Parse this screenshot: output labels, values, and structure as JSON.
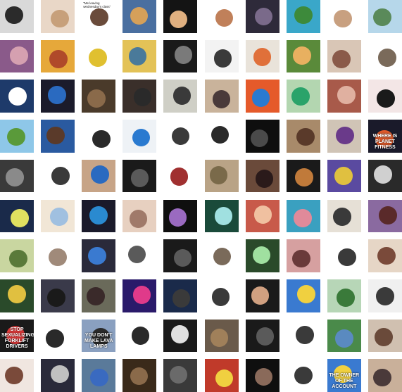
{
  "grid": {
    "cols": 10,
    "rows": 10,
    "tiles": [
      {
        "bg": "#d9d9d9",
        "fg": "#2b2b2b",
        "dark": true,
        "caption": "",
        "big": ""
      },
      {
        "bg": "#e9d7c7",
        "fg": "#c7a07b",
        "dark": false,
        "caption": "",
        "big": ""
      },
      {
        "bg": "#ffffff",
        "fg": "#6a4b3b",
        "dark": false,
        "caption": "\"Me leaving wednesday's class\"",
        "big": ""
      },
      {
        "bg": "#4a6fa0",
        "fg": "#d5a05a",
        "dark": true,
        "caption": "",
        "big": ""
      },
      {
        "bg": "#141414",
        "fg": "#e0b080",
        "dark": true,
        "caption": "",
        "big": ""
      },
      {
        "bg": "#ffffff",
        "fg": "#c0805a",
        "dark": false,
        "caption": "",
        "big": ""
      },
      {
        "bg": "#2e2a3a",
        "fg": "#7a6a8a",
        "dark": true,
        "caption": "",
        "big": ""
      },
      {
        "bg": "#3aa7c9",
        "fg": "#3d8a3b",
        "dark": true,
        "caption": "",
        "big": ""
      },
      {
        "bg": "#ffffff",
        "fg": "#c8a080",
        "dark": false,
        "caption": "",
        "big": ""
      },
      {
        "bg": "#b6d7ea",
        "fg": "#5a8a5a",
        "dark": false,
        "caption": "",
        "big": ""
      },
      {
        "bg": "#8a5a8a",
        "fg": "#d5a0b0",
        "dark": true,
        "caption": "",
        "big": ""
      },
      {
        "bg": "#e6a83a",
        "fg": "#b04a2a",
        "dark": false,
        "caption": "",
        "big": ""
      },
      {
        "bg": "#ffffff",
        "fg": "#e0c030",
        "dark": false,
        "caption": "",
        "big": ""
      },
      {
        "bg": "#e3c257",
        "fg": "#4a7a9a",
        "dark": false,
        "caption": "",
        "big": ""
      },
      {
        "bg": "#1a1a1a",
        "fg": "#7a7a7a",
        "dark": true,
        "caption": "",
        "big": ""
      },
      {
        "bg": "#f3f3f3",
        "fg": "#3a3a3a",
        "dark": false,
        "caption": "",
        "big": ""
      },
      {
        "bg": "#e9e3da",
        "fg": "#e0703a",
        "dark": false,
        "caption": "",
        "big": ""
      },
      {
        "bg": "#5a8a3a",
        "fg": "#e8b060",
        "dark": true,
        "caption": "",
        "big": ""
      },
      {
        "bg": "#d9c6b6",
        "fg": "#8a5a4a",
        "dark": false,
        "caption": "",
        "big": ""
      },
      {
        "bg": "#ffffff",
        "fg": "#7a6a5a",
        "dark": false,
        "caption": "",
        "big": ""
      },
      {
        "bg": "#1e3a6a",
        "fg": "#ffffff",
        "dark": true,
        "caption": "",
        "big": ""
      },
      {
        "bg": "#1b1b2b",
        "fg": "#2a6ac0",
        "dark": true,
        "caption": "",
        "big": ""
      },
      {
        "bg": "#4a3a2a",
        "fg": "#8a6a4a",
        "dark": true,
        "caption": "",
        "big": ""
      },
      {
        "bg": "#3a2f2a",
        "fg": "#2a2a2a",
        "dark": true,
        "caption": "",
        "big": ""
      },
      {
        "bg": "#cfcfc6",
        "fg": "#3a3a3a",
        "dark": false,
        "caption": "",
        "big": ""
      },
      {
        "bg": "#c9b39b",
        "fg": "#4a3a3a",
        "dark": false,
        "caption": "",
        "big": ""
      },
      {
        "bg": "#e55a2a",
        "fg": "#2a7ad0",
        "dark": true,
        "caption": "",
        "big": ""
      },
      {
        "bg": "#b3d6b0",
        "fg": "#2aa36a",
        "dark": false,
        "caption": "",
        "big": ""
      },
      {
        "bg": "#a85a4a",
        "fg": "#e0b0a0",
        "dark": true,
        "caption": "",
        "big": ""
      },
      {
        "bg": "#f3e6e6",
        "fg": "#1a1a1a",
        "dark": false,
        "caption": "",
        "big": ""
      },
      {
        "bg": "#8ec7e8",
        "fg": "#5a9a3a",
        "dark": false,
        "caption": "",
        "big": ""
      },
      {
        "bg": "#2a5aa0",
        "fg": "#5a3a2a",
        "dark": true,
        "caption": "",
        "big": ""
      },
      {
        "bg": "#ffffff",
        "fg": "#2a2a2a",
        "dark": false,
        "caption": "",
        "big": ""
      },
      {
        "bg": "#eef2f6",
        "fg": "#2a7ad0",
        "dark": false,
        "caption": "",
        "big": ""
      },
      {
        "bg": "#ffffff",
        "fg": "#3a3a3a",
        "dark": false,
        "caption": "",
        "big": ""
      },
      {
        "bg": "#ffffff",
        "fg": "#2a2a2a",
        "dark": false,
        "caption": "",
        "big": ""
      },
      {
        "bg": "#0e0e0e",
        "fg": "#4a4a4a",
        "dark": true,
        "caption": "",
        "big": ""
      },
      {
        "bg": "#a88a6a",
        "fg": "#5a3a2a",
        "dark": false,
        "caption": "",
        "big": ""
      },
      {
        "bg": "#d0c4b6",
        "fg": "#6a3a8a",
        "dark": false,
        "caption": "",
        "big": ""
      },
      {
        "bg": "#1a1a2a",
        "fg": "#e05a2a",
        "dark": true,
        "caption": "",
        "big": "WHERE IS  PLANET FITNESS"
      },
      {
        "bg": "#3a3a3a",
        "fg": "#8a8a8a",
        "dark": true,
        "caption": "",
        "big": ""
      },
      {
        "bg": "#ffffff",
        "fg": "#3a3a3a",
        "dark": false,
        "caption": "",
        "big": ""
      },
      {
        "bg": "#c7a487",
        "fg": "#2a6ac0",
        "dark": false,
        "caption": "",
        "big": ""
      },
      {
        "bg": "#1a1a1a",
        "fg": "#5a5a5a",
        "dark": true,
        "caption": "",
        "big": ""
      },
      {
        "bg": "#ffffff",
        "fg": "#a03030",
        "dark": false,
        "caption": "",
        "big": ""
      },
      {
        "bg": "#b9a386",
        "fg": "#7a6a4a",
        "dark": false,
        "caption": "",
        "big": ""
      },
      {
        "bg": "#6a4a3a",
        "fg": "#2a1a1a",
        "dark": true,
        "caption": "",
        "big": ""
      },
      {
        "bg": "#1a1a1a",
        "fg": "#c07a3a",
        "dark": true,
        "caption": "",
        "big": ""
      },
      {
        "bg": "#5a4aa0",
        "fg": "#e0c040",
        "dark": true,
        "caption": "",
        "big": ""
      },
      {
        "bg": "#2a2a2a",
        "fg": "#d0d0d0",
        "dark": true,
        "caption": "",
        "big": ""
      },
      {
        "bg": "#1a2a4a",
        "fg": "#e0e060",
        "dark": true,
        "caption": "",
        "big": ""
      },
      {
        "bg": "#f1e6d6",
        "fg": "#a0c0e0",
        "dark": false,
        "caption": "",
        "big": ""
      },
      {
        "bg": "#1a1a2a",
        "fg": "#2a8ad0",
        "dark": true,
        "caption": "",
        "big": ""
      },
      {
        "bg": "#e7d0c0",
        "fg": "#a07a6a",
        "dark": false,
        "caption": "",
        "big": ""
      },
      {
        "bg": "#0f0f0f",
        "fg": "#9a6ac0",
        "dark": true,
        "caption": "",
        "big": ""
      },
      {
        "bg": "#1a4a3a",
        "fg": "#a0e0e0",
        "dark": true,
        "caption": "",
        "big": ""
      },
      {
        "bg": "#c85a4a",
        "fg": "#f0c0a0",
        "dark": true,
        "caption": "",
        "big": ""
      },
      {
        "bg": "#3aa0c0",
        "fg": "#e08a9a",
        "dark": false,
        "caption": "",
        "big": ""
      },
      {
        "bg": "#e6e0d6",
        "fg": "#3a3a3a",
        "dark": false,
        "caption": "",
        "big": ""
      },
      {
        "bg": "#8a6aa0",
        "fg": "#5a2a2a",
        "dark": true,
        "caption": "",
        "big": ""
      },
      {
        "bg": "#c9d6a0",
        "fg": "#5a7a3a",
        "dark": false,
        "caption": "",
        "big": ""
      },
      {
        "bg": "#ffffff",
        "fg": "#a08a7a",
        "dark": false,
        "caption": "",
        "big": ""
      },
      {
        "bg": "#2a2a3a",
        "fg": "#3a7ad0",
        "dark": true,
        "caption": "",
        "big": ""
      },
      {
        "bg": "#ffffff",
        "fg": "#5a5a5a",
        "dark": false,
        "caption": "",
        "big": ""
      },
      {
        "bg": "#1a1a1a",
        "fg": "#5a5a5a",
        "dark": true,
        "caption": "",
        "big": ""
      },
      {
        "bg": "#ffffff",
        "fg": "#7a6a5a",
        "dark": false,
        "caption": "",
        "big": ""
      },
      {
        "bg": "#2a4a2a",
        "fg": "#a0e0a0",
        "dark": true,
        "caption": "",
        "big": ""
      },
      {
        "bg": "#d6a0a0",
        "fg": "#6a3a3a",
        "dark": false,
        "caption": "",
        "big": ""
      },
      {
        "bg": "#ffffff",
        "fg": "#3a3a3a",
        "dark": false,
        "caption": "",
        "big": ""
      },
      {
        "bg": "#e6d6c6",
        "fg": "#7a4a3a",
        "dark": false,
        "caption": "",
        "big": ""
      },
      {
        "bg": "#2a4a2a",
        "fg": "#e0c040",
        "dark": true,
        "caption": "",
        "big": ""
      },
      {
        "bg": "#3a3a4a",
        "fg": "#1a1a1a",
        "dark": true,
        "caption": "",
        "big": ""
      },
      {
        "bg": "#6a6a5a",
        "fg": "#3a2a2a",
        "dark": true,
        "caption": "",
        "big": ""
      },
      {
        "bg": "#2a1a6a",
        "fg": "#e03a8a",
        "dark": true,
        "caption": "",
        "big": ""
      },
      {
        "bg": "#1a2a4a",
        "fg": "#3a3a3a",
        "dark": true,
        "caption": "",
        "big": ""
      },
      {
        "bg": "#ffffff",
        "fg": "#3a3a3a",
        "dark": false,
        "caption": "",
        "big": ""
      },
      {
        "bg": "#1a1a1a",
        "fg": "#d0a080",
        "dark": true,
        "caption": "",
        "big": ""
      },
      {
        "bg": "#3a7ad0",
        "fg": "#f0d040",
        "dark": true,
        "caption": "",
        "big": ""
      },
      {
        "bg": "#b7d6b7",
        "fg": "#3a7a3a",
        "dark": false,
        "caption": "",
        "big": ""
      },
      {
        "bg": "#f0f0f0",
        "fg": "#3a3a3a",
        "dark": false,
        "caption": "",
        "big": ""
      },
      {
        "bg": "#1a1a1a",
        "fg": "#e03a3a",
        "dark": true,
        "caption": "",
        "big": "STOP SEXUALIZING FORKLIFT DRIVERS"
      },
      {
        "bg": "#ffffff",
        "fg": "#2a2a2a",
        "dark": false,
        "caption": "",
        "big": ""
      },
      {
        "bg": "#8aa0c0",
        "fg": "#2a2a2a",
        "dark": false,
        "caption": "",
        "big": "YOU DON'T MAKE LAVA LAMPS"
      },
      {
        "bg": "#ffffff",
        "fg": "#2a2a2a",
        "dark": false,
        "caption": "",
        "big": ""
      },
      {
        "bg": "#1a1a1a",
        "fg": "#e0e0e0",
        "dark": true,
        "caption": "",
        "big": ""
      },
      {
        "bg": "#6a5a4a",
        "fg": "#a0805a",
        "dark": true,
        "caption": "",
        "big": ""
      },
      {
        "bg": "#1a1a1a",
        "fg": "#5a5a5a",
        "dark": true,
        "caption": "",
        "big": ""
      },
      {
        "bg": "#ffffff",
        "fg": "#3a3a3a",
        "dark": false,
        "caption": "",
        "big": ""
      },
      {
        "bg": "#4a8a4a",
        "fg": "#5a8ac0",
        "dark": true,
        "caption": "",
        "big": ""
      },
      {
        "bg": "#d0c0b0",
        "fg": "#6a4a3a",
        "dark": false,
        "caption": "",
        "big": ""
      },
      {
        "bg": "#f0e6e0",
        "fg": "#7a4a3a",
        "dark": false,
        "caption": "",
        "big": ""
      },
      {
        "bg": "#2a2a3a",
        "fg": "#c0c0c0",
        "dark": true,
        "caption": "",
        "big": ""
      },
      {
        "bg": "#5a7a9a",
        "fg": "#3a6ac0",
        "dark": true,
        "caption": "",
        "big": ""
      },
      {
        "bg": "#3a2a1a",
        "fg": "#8a6a4a",
        "dark": true,
        "caption": "",
        "big": ""
      },
      {
        "bg": "#3a3a3a",
        "fg": "#6a6a6a",
        "dark": true,
        "caption": "",
        "big": ""
      },
      {
        "bg": "#c03a2a",
        "fg": "#f0d040",
        "dark": true,
        "caption": "",
        "big": ""
      },
      {
        "bg": "#0f0f0f",
        "fg": "#8a6a5a",
        "dark": true,
        "caption": "",
        "big": ""
      },
      {
        "bg": "#ffffff",
        "fg": "#3a3a3a",
        "dark": false,
        "caption": "",
        "big": ""
      },
      {
        "bg": "#3a7ad0",
        "fg": "#f0d040",
        "dark": true,
        "caption": "",
        "big": "THE OWNER OF THE ACCOUNT"
      },
      {
        "bg": "#c9b09a",
        "fg": "#4a3a3a",
        "dark": false,
        "caption": "",
        "big": ""
      }
    ]
  }
}
